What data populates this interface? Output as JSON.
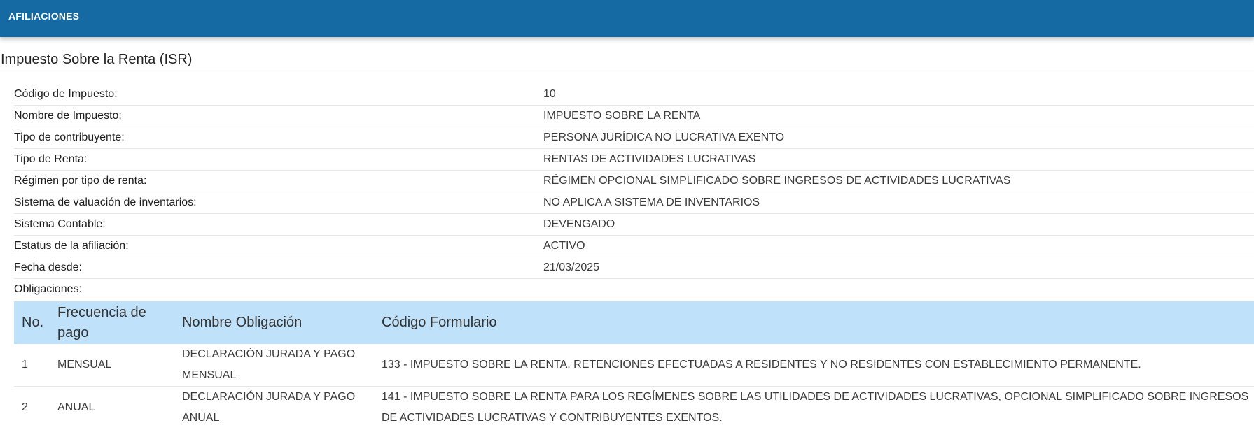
{
  "header": {
    "title": "AFILIACIONES"
  },
  "section": {
    "title": "Impuesto Sobre la Renta (ISR)"
  },
  "info_rows": [
    {
      "label": "Código de Impuesto:",
      "value": "10"
    },
    {
      "label": "Nombre de Impuesto:",
      "value": "IMPUESTO SOBRE LA RENTA"
    },
    {
      "label": "Tipo de contribuyente:",
      "value": "PERSONA JURÍDICA NO LUCRATIVA EXENTO"
    },
    {
      "label": "Tipo de Renta:",
      "value": "RENTAS DE ACTIVIDADES LUCRATIVAS"
    },
    {
      "label": "Régimen por tipo de renta:",
      "value": "RÉGIMEN OPCIONAL SIMPLIFICADO SOBRE INGRESOS DE ACTIVIDADES LUCRATIVAS"
    },
    {
      "label": "Sistema de valuación de inventarios:",
      "value": "NO APLICA A SISTEMA DE INVENTARIOS"
    },
    {
      "label": "Sistema Contable:",
      "value": "DEVENGADO"
    },
    {
      "label": "Estatus de la afiliación:",
      "value": "ACTIVO"
    },
    {
      "label": "Fecha desde:",
      "value": "21/03/2025"
    },
    {
      "label": "Obligaciones:",
      "value": ""
    }
  ],
  "obligations": {
    "columns": [
      "No.",
      "Frecuencia de pago",
      "Nombre Obligación",
      "Código Formulario"
    ],
    "rows": [
      {
        "no": "1",
        "frequency": "MENSUAL",
        "name": "DECLARACIÓN JURADA Y PAGO MENSUAL",
        "form": "133 - IMPUESTO SOBRE LA RENTA, RETENCIONES EFECTUADAS A RESIDENTES Y NO RESIDENTES CON ESTABLECIMIENTO PERMANENTE."
      },
      {
        "no": "2",
        "frequency": "ANUAL",
        "name": "DECLARACIÓN JURADA Y PAGO ANUAL",
        "form": "141 - IMPUESTO SOBRE LA RENTA PARA LOS REGÍMENES SOBRE LAS UTILIDADES DE ACTIVIDADES LUCRATIVAS, OPCIONAL SIMPLIFICADO SOBRE INGRESOS DE ACTIVIDADES LUCRATIVAS Y CONTRIBUYENTES EXENTOS."
      }
    ]
  }
}
